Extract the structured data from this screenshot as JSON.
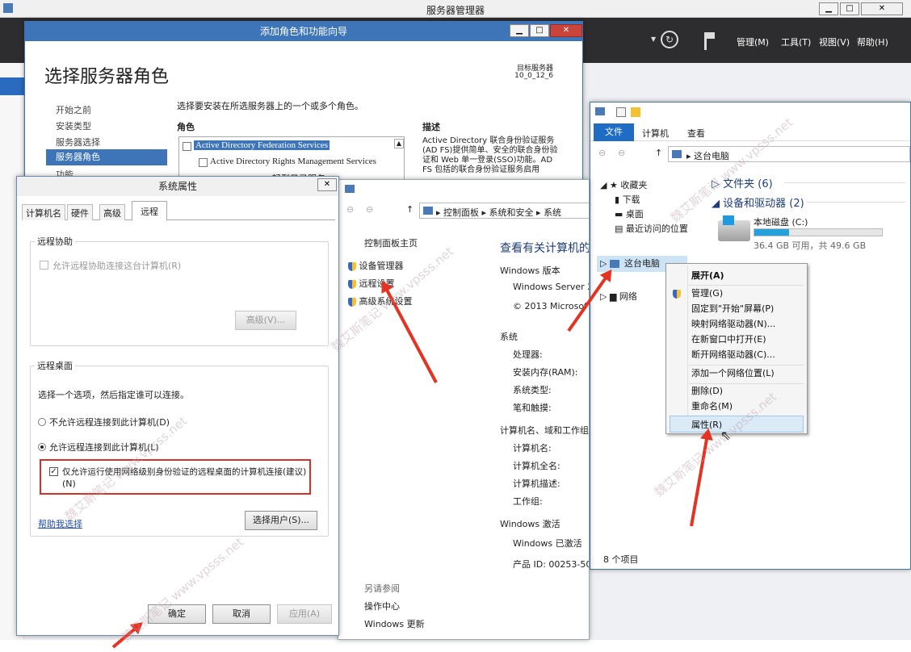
{
  "server_manager": {
    "title": "服务器管理器",
    "menu": [
      "管理(M)",
      "工具(T)",
      "视图(V)",
      "帮助(H)"
    ]
  },
  "wizard": {
    "title": "添加角色和功能向导",
    "heading": "选择服务器角色",
    "target_label": "目标服务器",
    "target_value": "10_0_12_6",
    "instruction": "选择要安装在所选服务器上的一个或多个角色。",
    "roles_header": "角色",
    "desc_header": "描述",
    "nav": [
      "开始之前",
      "安装类型",
      "服务器选择",
      "服务器角色",
      "功能"
    ],
    "roles": [
      "Active Directory Federation Services",
      "Active Directory Rights Management Services",
      "Active Directory 轻型目录服务"
    ],
    "description": "Active Directory 联合身份验证服务 (AD FS)提供简单、安全的联合身份验证和 Web 单一登录(SSO)功能。AD FS 包括的联合身份验证服务启用"
  },
  "sysprop": {
    "title": "系统属性",
    "tabs": [
      "计算机名",
      "硬件",
      "高级",
      "远程"
    ],
    "ra_group": "远程协助",
    "ra_checkbox": "允许远程协助连接这台计算机(R)",
    "ra_advanced": "高级(V)...",
    "rd_group": "远程桌面",
    "rd_instruction": "选择一个选项，然后指定谁可以连接。",
    "rd_opt1": "不允许远程连接到此计算机(D)",
    "rd_opt2": "允许远程连接到此计算机(L)",
    "rd_nla": "仅允许运行使用网络级别身份验证的远程桌面的计算机连接(建议)",
    "rd_nla_key": "(N)",
    "help_link": "帮助我选择",
    "select_users": "选择用户(S)...",
    "ok": "确定",
    "cancel": "取消",
    "apply": "应用(A)"
  },
  "cpanel": {
    "breadcrumb": [
      "控制面板",
      "系统和安全",
      "系统"
    ],
    "home": "控制面板主页",
    "links": [
      "设备管理器",
      "远程设置",
      "高级系统设置"
    ],
    "heading": "查看有关计算机的",
    "edition_section": "Windows 版本",
    "edition": "Windows Server 20",
    "copyright": "© 2013 Microsof",
    "system_section": "系统",
    "system_fields": [
      "处理器:",
      "安装内存(RAM):",
      "系统类型:",
      "笔和触摸:"
    ],
    "name_section": "计算机名、域和工作组设",
    "name_fields": [
      "计算机名:",
      "计算机全名:",
      "计算机描述:",
      "工作组:"
    ],
    "activation_section": "Windows 激活",
    "activation_status": "Windows 已激活",
    "product_id": "产品 ID: 00253-500",
    "see_also": "另请参阅",
    "see_also_links": [
      "操作中心",
      "Windows 更新"
    ]
  },
  "explorer": {
    "ribbon_tabs": [
      "文件",
      "计算机",
      "查看"
    ],
    "address": "这台电脑",
    "nav": {
      "favorites": "收藏夹",
      "downloads": "下载",
      "desktop": "桌面",
      "recent": "最近访问的位置",
      "this_pc": "这台电脑",
      "network": "网络"
    },
    "folders_group": "文件夹 (6)",
    "devices_group": "设备和驱动器 (2)",
    "drive_name": "本地磁盘 (C:)",
    "drive_fill": 0.27,
    "drive_info": "36.4 GB 可用，共 49.6 GB",
    "status": "8 个项目"
  },
  "context_menu": {
    "items": [
      "展开(A)",
      "管理(G)",
      "固定到\"开始\"屏幕(P)",
      "映射网络驱动器(N)...",
      "在新窗口中打开(E)",
      "断开网络驱动器(C)...",
      "添加一个网络位置(L)",
      "删除(D)",
      "重命名(M)",
      "属性(R)"
    ]
  },
  "watermark": "魏艾斯笔记 www.vpsss.net"
}
